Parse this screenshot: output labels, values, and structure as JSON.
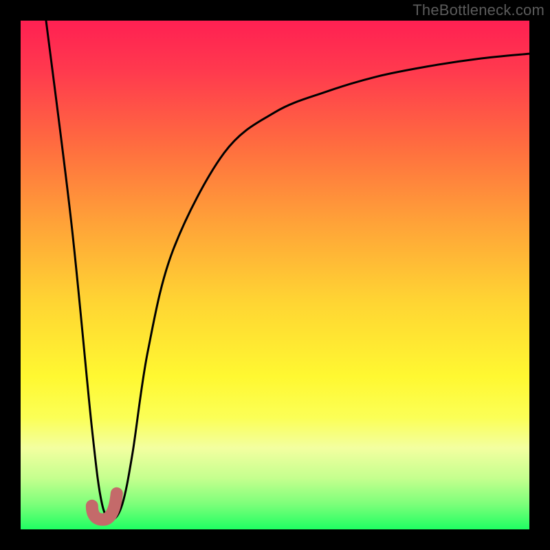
{
  "watermark": "TheBottleneck.com",
  "chart_data": {
    "type": "line",
    "title": "",
    "xlabel": "",
    "ylabel": "",
    "xlim": [
      0,
      100
    ],
    "ylim": [
      0,
      100
    ],
    "series": [
      {
        "name": "bottleneck-curve",
        "x": [
          5,
          10,
          14,
          16,
          18,
          20,
          22,
          25,
          30,
          40,
          50,
          60,
          70,
          80,
          90,
          100
        ],
        "y": [
          100,
          60,
          20,
          5,
          2,
          5,
          15,
          35,
          55,
          74,
          82,
          86,
          89,
          91,
          92.5,
          93.5
        ]
      }
    ],
    "marker": {
      "name": "optimal-point",
      "shape": "checkmark",
      "color": "#c46a6a",
      "x": 17,
      "y": 3
    },
    "gradient_stops": [
      {
        "offset": 0,
        "color": "#ff2052"
      },
      {
        "offset": 25,
        "color": "#ff6e3f"
      },
      {
        "offset": 55,
        "color": "#ffd433"
      },
      {
        "offset": 78,
        "color": "#fbff56"
      },
      {
        "offset": 100,
        "color": "#1fff62"
      }
    ]
  }
}
